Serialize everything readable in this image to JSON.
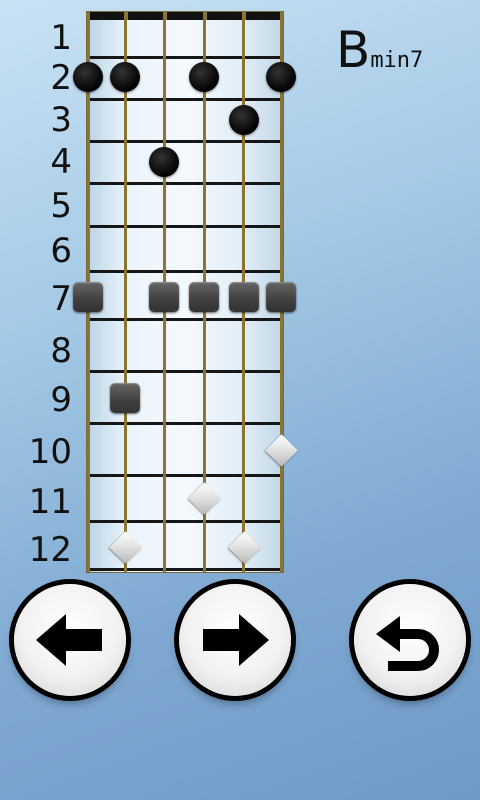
{
  "fret_numbers": [
    "1",
    "2",
    "3",
    "4",
    "5",
    "6",
    "7",
    "8",
    "9",
    "10",
    "11",
    "12"
  ],
  "chord": {
    "root": "B",
    "quality": "min7"
  },
  "colors": {
    "accent_dark": "#000000",
    "string": "#8a7433",
    "marker_light": "#e0e0e0"
  },
  "notes": {
    "circle_markers": [
      {
        "string": 1,
        "fret": 2
      },
      {
        "string": 2,
        "fret": 2
      },
      {
        "string": 4,
        "fret": 2
      },
      {
        "string": 6,
        "fret": 2
      },
      {
        "string": 5,
        "fret": 3
      },
      {
        "string": 3,
        "fret": 4
      }
    ],
    "square_markers": [
      {
        "string": 1,
        "fret": 7
      },
      {
        "string": 3,
        "fret": 7
      },
      {
        "string": 4,
        "fret": 7
      },
      {
        "string": 5,
        "fret": 7
      },
      {
        "string": 6,
        "fret": 7
      },
      {
        "string": 2,
        "fret": 9
      }
    ],
    "diamond_markers": [
      {
        "string": 6,
        "fret": 10
      },
      {
        "string": 4,
        "fret": 11
      },
      {
        "string": 2,
        "fret": 12
      },
      {
        "string": 5,
        "fret": 12
      }
    ]
  },
  "buttons": {
    "previous": {
      "icon": "arrow-left-icon"
    },
    "next": {
      "icon": "arrow-right-icon"
    },
    "back": {
      "icon": "return-icon"
    }
  }
}
